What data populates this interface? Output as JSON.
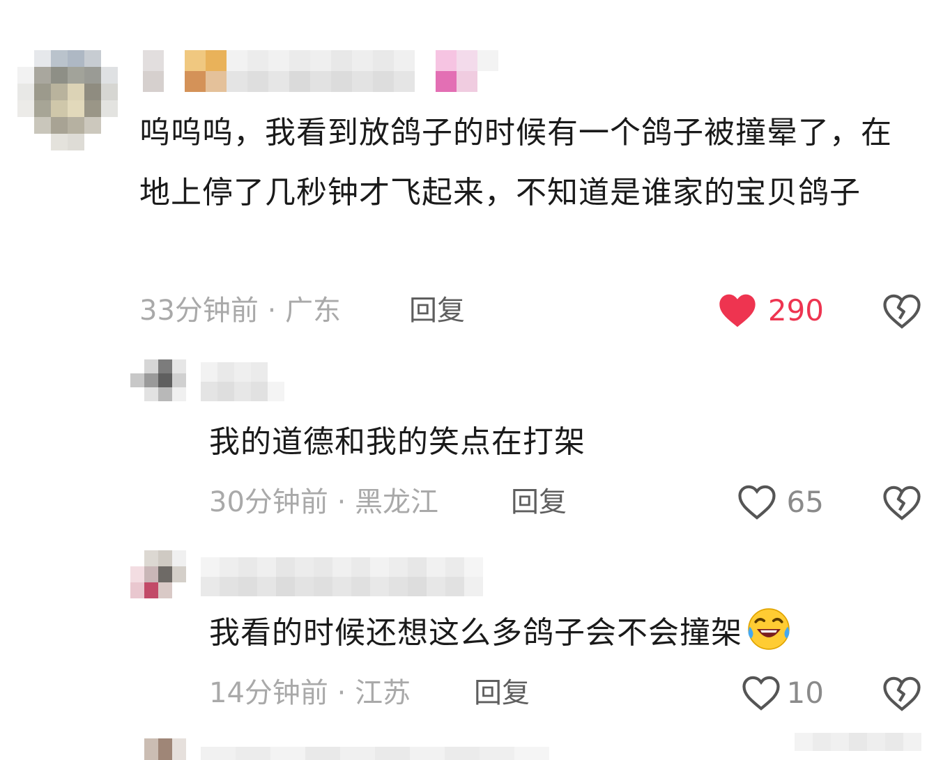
{
  "comments": [
    {
      "text": "呜呜呜，我看到放鸽子的时候有一个鸽子被撞晕了，在地上停了几秒钟才飞起来，不知道是谁家的宝贝鸽子",
      "time": "33分钟前",
      "sep": "·",
      "location": "广东",
      "reply": "回复",
      "likes": "290",
      "liked": true
    },
    {
      "text": "我的道德和我的笑点在打架",
      "time": "30分钟前",
      "sep": "·",
      "location": "黑龙江",
      "reply": "回复",
      "likes": "65",
      "liked": false
    },
    {
      "text": "我看的时候还想这么多鸽子会不会撞架",
      "emoji": "rofl-emoji",
      "time": "14分钟前",
      "sep": "·",
      "location": "江苏",
      "reply": "回复",
      "likes": "10",
      "liked": false
    }
  ],
  "icons": {
    "like": "heart-icon",
    "dislike": "broken-heart-icon"
  },
  "colors": {
    "liked": "#ee3450",
    "meta": "#a9a9a9",
    "reply": "#5e5e5e",
    "text": "#1a1a1a"
  }
}
